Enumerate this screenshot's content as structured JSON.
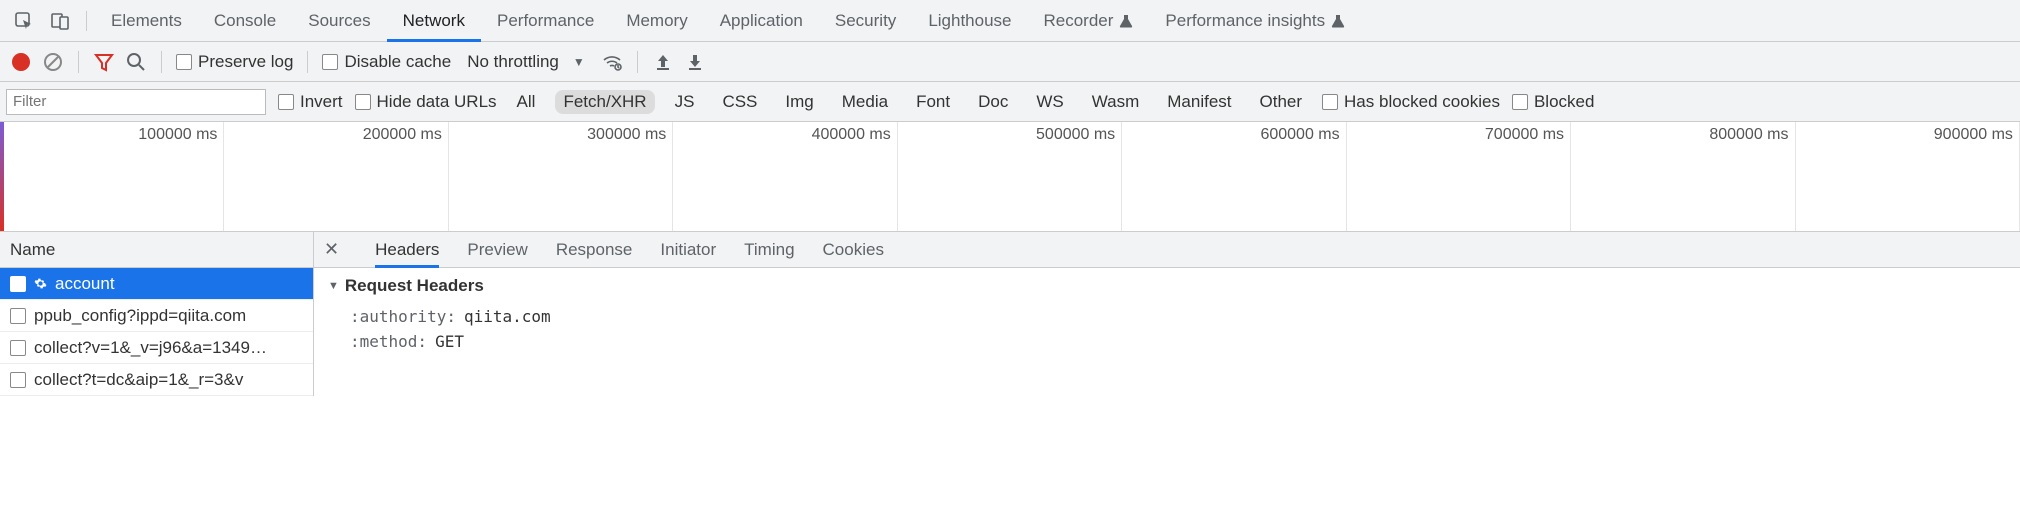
{
  "mainTabs": {
    "elements": "Elements",
    "console": "Console",
    "sources": "Sources",
    "network": "Network",
    "performance": "Performance",
    "memory": "Memory",
    "application": "Application",
    "security": "Security",
    "lighthouse": "Lighthouse",
    "recorder": "Recorder",
    "perfInsights": "Performance insights"
  },
  "toolbar": {
    "preserveLog": "Preserve log",
    "disableCache": "Disable cache",
    "throttling": "No throttling"
  },
  "filter": {
    "placeholder": "Filter",
    "invert": "Invert",
    "hideDataUrls": "Hide data URLs",
    "types": {
      "all": "All",
      "fetchXhr": "Fetch/XHR",
      "js": "JS",
      "css": "CSS",
      "img": "Img",
      "media": "Media",
      "font": "Font",
      "doc": "Doc",
      "ws": "WS",
      "wasm": "Wasm",
      "manifest": "Manifest",
      "other": "Other"
    },
    "hasBlockedCookies": "Has blocked cookies",
    "blocked": "Blocked"
  },
  "timeline": {
    "ticks": [
      "100000 ms",
      "200000 ms",
      "300000 ms",
      "400000 ms",
      "500000 ms",
      "600000 ms",
      "700000 ms",
      "800000 ms",
      "900000 ms"
    ]
  },
  "requests": {
    "nameHeader": "Name",
    "items": [
      "account",
      "ppub_config?ippd=qiita.com",
      "collect?v=1&_v=j96&a=1349…",
      "collect?t=dc&aip=1&_r=3&v"
    ]
  },
  "detail": {
    "tabs": {
      "headers": "Headers",
      "preview": "Preview",
      "response": "Response",
      "initiator": "Initiator",
      "timing": "Timing",
      "cookies": "Cookies"
    },
    "sectionTitle": "Request Headers",
    "headersKv": [
      {
        "k": ":authority:",
        "v": "qiita.com"
      },
      {
        "k": ":method:",
        "v": "GET"
      }
    ]
  }
}
